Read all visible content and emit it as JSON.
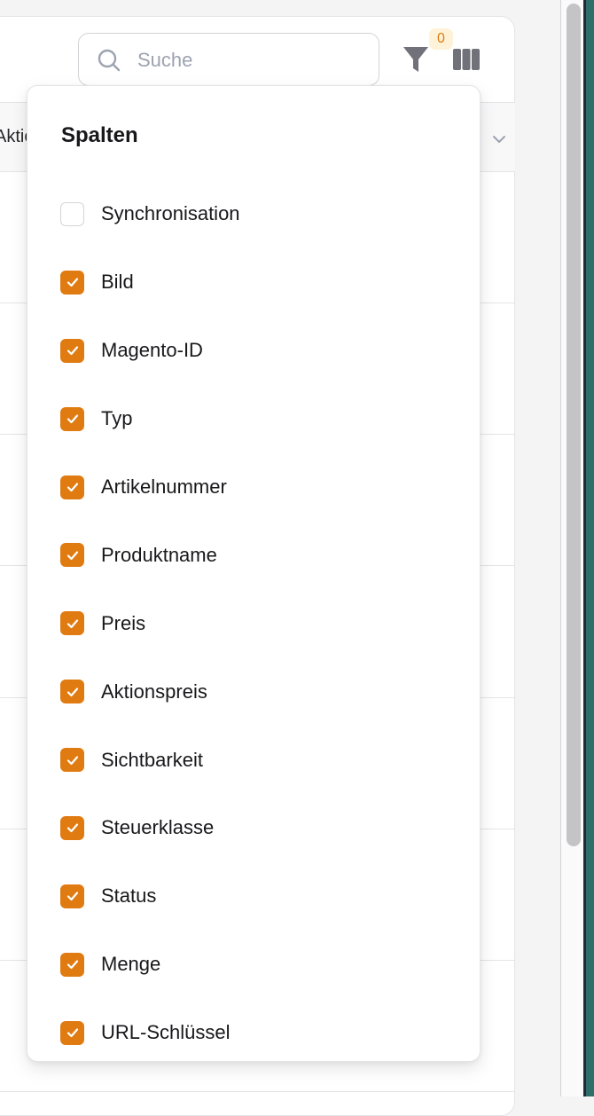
{
  "search": {
    "placeholder": "Suche"
  },
  "filter": {
    "active_count": "0"
  },
  "table": {
    "partial_column_label": "Aktio"
  },
  "column_picker": {
    "title": "Spalten",
    "columns": [
      {
        "label": "Synchronisation",
        "checked": false
      },
      {
        "label": "Bild",
        "checked": true
      },
      {
        "label": "Magento-ID",
        "checked": true
      },
      {
        "label": "Typ",
        "checked": true
      },
      {
        "label": "Artikelnummer",
        "checked": true
      },
      {
        "label": "Produktname",
        "checked": true
      },
      {
        "label": "Preis",
        "checked": true
      },
      {
        "label": "Aktionspreis",
        "checked": true
      },
      {
        "label": "Sichtbarkeit",
        "checked": true
      },
      {
        "label": "Steuerklasse",
        "checked": true
      },
      {
        "label": "Status",
        "checked": true
      },
      {
        "label": "Menge",
        "checked": true
      },
      {
        "label": "URL-Schlüssel",
        "checked": true
      }
    ]
  },
  "colors": {
    "accent": "#e07b12",
    "badge_bg": "#fef3d8",
    "icon_gray": "#71717a"
  }
}
